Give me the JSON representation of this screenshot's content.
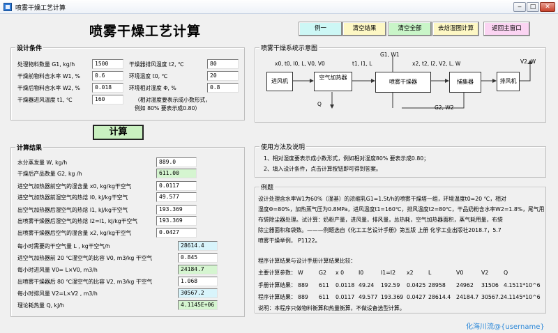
{
  "window": {
    "title": "喷雾干燥工艺计算",
    "min": "‒",
    "max": "□",
    "close": "✕"
  },
  "main_title": "喷雾干燥工艺计算",
  "toolbar": [
    {
      "label": "例一",
      "color": "#cdf7f5"
    },
    {
      "label": "清空结果",
      "color": "#fdf7c4"
    },
    {
      "label": "清空全部",
      "color": "#c9f5c8"
    },
    {
      "label": "去焓湿图计算",
      "color": "#fdf7c4"
    },
    {
      "label": "返回主窗口",
      "color": "#fbd4f2"
    }
  ],
  "conditions": {
    "legend": "设计条件",
    "rows": [
      {
        "label": "处理物料数量 G1, kg/h",
        "value": "1500"
      },
      {
        "label": "干燥前物料含水率 W1, %",
        "value": "0.6"
      },
      {
        "label": "干燥后物料含水率 W2, %",
        "value": "0.018"
      },
      {
        "label": "干燥器进风温度 t1, ℃",
        "value": "160"
      }
    ],
    "rows2": [
      {
        "label": "干燥器排风温度 t2, ℃",
        "value": "80"
      },
      {
        "label": "环境温度 t0, ℃",
        "value": "20"
      },
      {
        "label": "环境相对湿度 Φ,  %",
        "value": "0.8"
      }
    ],
    "note1": "（相对湿度要表示成小数形式，",
    "note2": "例如 80% 要表示成0.80）"
  },
  "calc_button": "计算",
  "results": {
    "legend": "计算结果",
    "rows": [
      {
        "label": "水分蒸发量 W,  kg/h",
        "value": "889.0",
        "color": "#ffffff"
      },
      {
        "label": "干燥后产品数量 G2,  kg /h",
        "value": "611.00",
        "color": "#d5f5d0"
      },
      {
        "label": "进空气加热器前空气的湿含量 x0, kg/kg干空气",
        "value": "0.0117",
        "color": "#ffffff"
      },
      {
        "label": "进空气加热器前湿空气的热焓 I0, kJ/kg干空气",
        "value": "49.577",
        "color": "#ffffff"
      },
      {
        "label": "出空气加热器后湿空气的热焓 I1, kJ/kg干空气",
        "value": "193.369",
        "color": "#ffffff"
      },
      {
        "label": "出喷雾干燥器后湿空气的热焓 I2=I1,  kJ/kg干空气",
        "value": "193.369",
        "color": "#ffffff"
      },
      {
        "label": "出喷雾干燥器后空气的湿含量 x2, kg/kg干空气",
        "value": "0.0427",
        "color": "#ffffff"
      }
    ],
    "rows2": [
      {
        "label": "每小时需要的干空气量 L ,  kg干空气/h",
        "value": "28614.4",
        "color": "#d8f4fb"
      },
      {
        "label": "进空气加热器前 20 ℃湿空气的比容 V0,  m3/kg 干空气",
        "value": "0.845",
        "color": "#ffffff"
      },
      {
        "label": "每小时进风量 V0= L×V0,  m3/h",
        "value": "24184.7",
        "color": "#d5f5d0"
      },
      {
        "label": "出喷雾干燥器后 80 ℃湿空气的比容 V2,  m3/kg 干空气",
        "value": "1.068",
        "color": "#ffffff"
      },
      {
        "label": "每小时排风量 V2=L×V2 ,  m3/h",
        "value": "30567.2",
        "color": "#d8f4fb"
      },
      {
        "label": "理论耗热量 Q,  kJ/h",
        "value": "4.1145E+06",
        "color": "#d5f5d0"
      }
    ]
  },
  "diagram": {
    "legend": "喷雾干燥系统示意图",
    "boxes": [
      "进风机",
      "空气加热器",
      "喷雾干燥器",
      "捕集器",
      "排风机"
    ],
    "labels": {
      "in_state": "x0, t0, I0, L, V0, V0",
      "after_heater": "t1, I1, L",
      "feed": "G1, W1",
      "out_state": "x2, t2, I2, V2, L, W",
      "exhaust": "V2, W",
      "heat": "Q",
      "product": "G2, W2"
    }
  },
  "usage": {
    "legend": "使用方法及说明",
    "line1": "1、相对湿度要表示成小数形式，例如相对湿度80% 要表示成0.80；",
    "line2": "2、填入设计条件，点击计算按钮即可得到答案。"
  },
  "example": {
    "legend": "例题",
    "lines": [
      "    设计处理含水率W1为60%（湿基）的浓缩乳G1=1.5t/h的喷雾干燥塔一组，环境温度t0=20 ℃，相对",
      "湿度Φ=80%，加热蒸气压为0.8MPa，进风温度t1=160℃，排风温度t2=80℃，干品奶粉含水率W2=1.8%，尾气用",
      "布袋除尘器处理。试计算：奶粉产量，进风量，排风量，总热耗，空气加热器面积，蒸气耗用量，布袋",
      "除尘器面积和袋数。———例题选自《化工工艺设计手册》第五版 上册 化学工业出版社2018.7，5.7",
      "喷雾干燥举例，  P1122。"
    ],
    "compare_title": "程序计算结果与设计手册计算结果比较：",
    "compare_rows": [
      {
        "c0": "主要计算参数：",
        "c1": "W",
        "c2": "G2",
        "c3": "x 0",
        "c4": "I0",
        "c5": "I1=I2",
        "c6": "x2",
        "c7": "L",
        "c8": "V0",
        "c9": "V2",
        "c10": "Q"
      },
      {
        "c0": "手册计算结果：",
        "c1": "889",
        "c2": "611",
        "c3": "0.0118",
        "c4": "49.24",
        "c5": "192.59",
        "c6": "0.0425",
        "c7": "28958",
        "c8": "24962",
        "c9": "31506",
        "c10": "4.1511*10^6"
      },
      {
        "c0": "程序计算结果：",
        "c1": "889",
        "c2": "611",
        "c3": "0.0117",
        "c4": "49.577",
        "c5": "193.369",
        "c6": "0.0427",
        "c7": "28614.4",
        "c8": "24184.7",
        "c9": "30567.2",
        "c10": "4.1145*10^6"
      }
    ],
    "note": "说明：本程序只做物料衡算和热量衡算，不做设备选型计算。"
  },
  "watermark": "化海川流@{username}"
}
